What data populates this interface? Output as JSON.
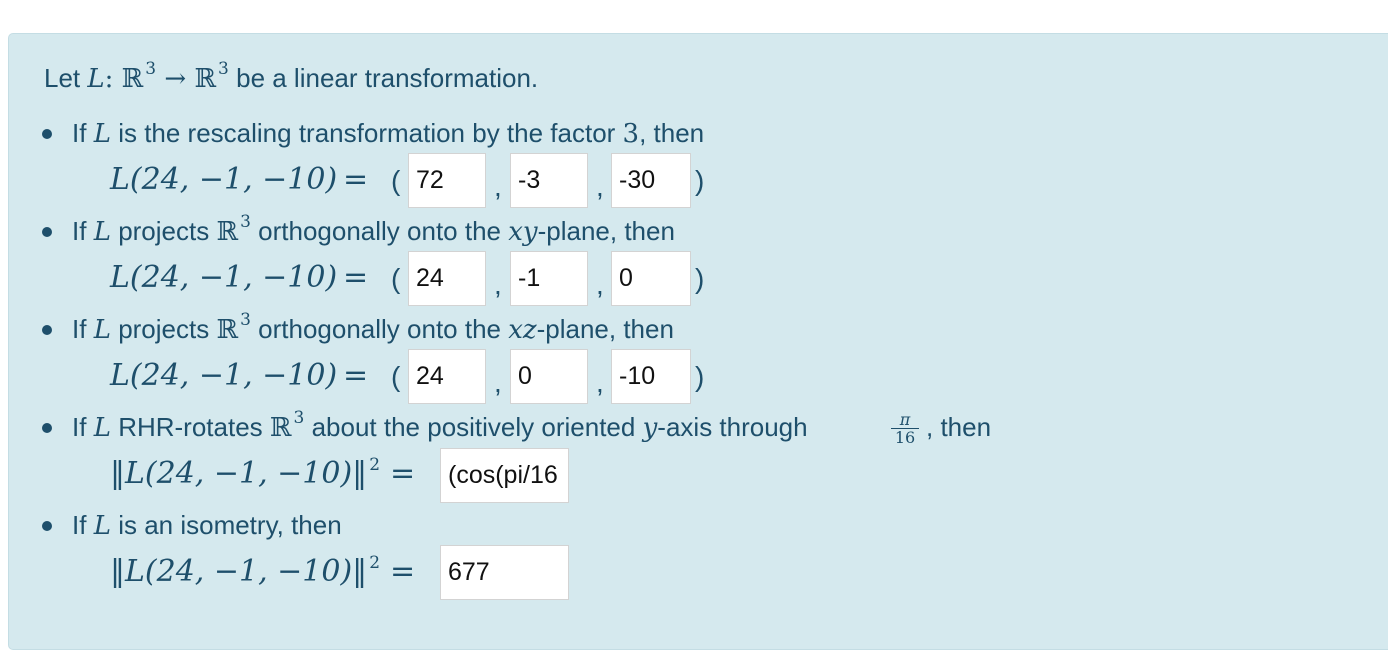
{
  "intro": {
    "prefix": "Let",
    "map_letter": "L",
    "domain_text": ": ℝ",
    "domain_exp": "3",
    "arrow": " → ℝ",
    "codomain_exp": "3",
    "suffix": "be a linear transformation."
  },
  "items": [
    {
      "pre": "If",
      "mid": "is the rescaling transformation by the factor",
      "factor": "3",
      "post": ", then",
      "lhs": "L(24, −1, −10)",
      "eq": "=",
      "answers": [
        "72",
        "-3",
        "-30"
      ]
    },
    {
      "pre": "If",
      "mid1": "projects",
      "space": "ℝ",
      "space_exp": "3",
      "mid2": "orthogonally onto the",
      "plane": "xy",
      "post": "-plane, then",
      "lhs": "L(24, −1, −10)",
      "eq": "=",
      "answers": [
        "24",
        "-1",
        "0"
      ]
    },
    {
      "pre": "If",
      "mid1": "projects",
      "space": "ℝ",
      "space_exp": "3",
      "mid2": "orthogonally onto the",
      "plane": "xz",
      "post": "-plane, then",
      "lhs": "L(24, −1, −10)",
      "eq": "=",
      "answers": [
        "24",
        "0",
        "-10"
      ]
    },
    {
      "pre": "If",
      "mid1": "RHR-rotates",
      "space": "ℝ",
      "space_exp": "3",
      "mid2": "about the positively oriented",
      "axis": "y",
      "mid3": "-axis through",
      "angle_num": "π",
      "angle_den": "16",
      "post": ", then",
      "lhs": "‖L(24, −1, −10)‖",
      "lhs_exp": "2",
      "eq": "=",
      "answer": "(cos(pi/16"
    },
    {
      "pre": "If",
      "mid": "is an isometry, then",
      "lhs": "‖L(24, −1, −10)‖",
      "lhs_exp": "2",
      "eq": "=",
      "answer": "677"
    }
  ],
  "punct": {
    "open_paren": "(",
    "comma": ",",
    "close_paren": ")"
  },
  "colors": {
    "panel_bg": "#d5e9ee",
    "text": "#1e4f6b",
    "input_bg": "#ffffff"
  }
}
